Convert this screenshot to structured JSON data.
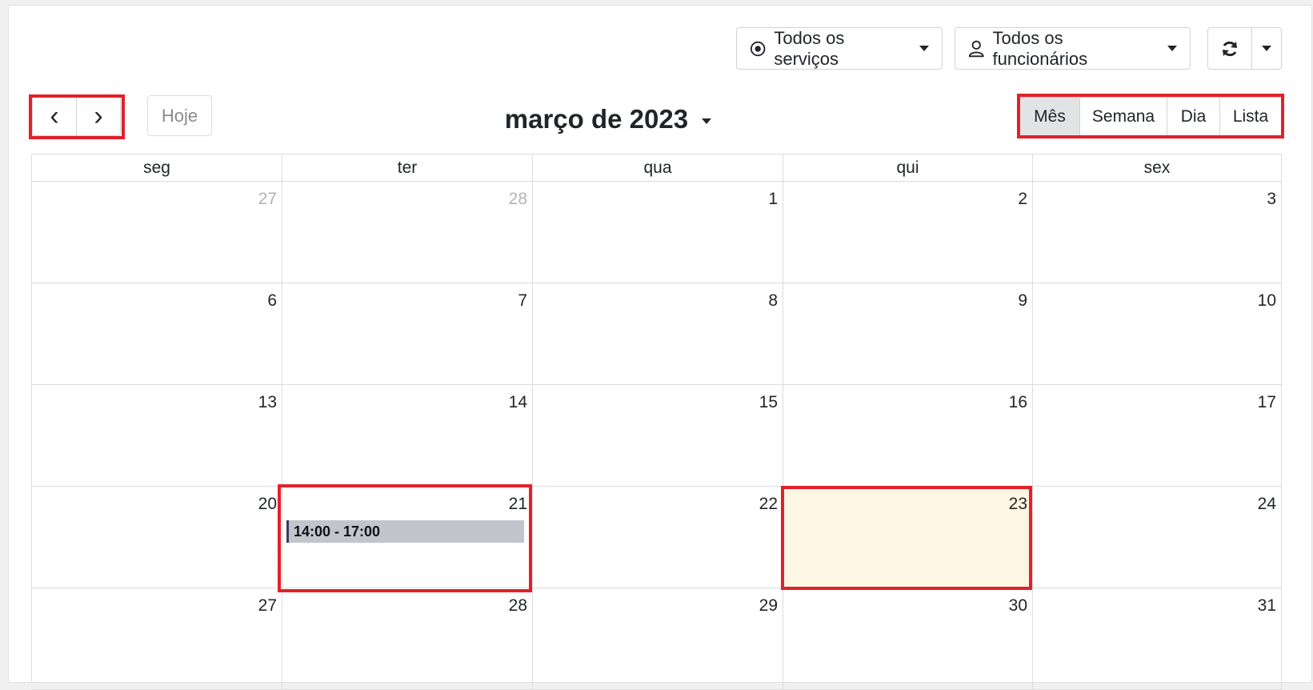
{
  "toolbar": {
    "services_label": "Todos os serviços",
    "employees_label": "Todos os funcionários",
    "today_label": "Hoje",
    "prev_icon": "‹",
    "next_icon": "›"
  },
  "calendar": {
    "title": "março de 2023",
    "views": [
      {
        "label": "Mês",
        "active": true
      },
      {
        "label": "Semana",
        "active": false
      },
      {
        "label": "Dia",
        "active": false
      },
      {
        "label": "Lista",
        "active": false
      }
    ],
    "weekdays": [
      "seg",
      "ter",
      "qua",
      "qui",
      "sex"
    ],
    "weeks": [
      [
        "27",
        "28",
        "1",
        "2",
        "3"
      ],
      [
        "6",
        "7",
        "8",
        "9",
        "10"
      ],
      [
        "13",
        "14",
        "15",
        "16",
        "17"
      ],
      [
        "20",
        "21",
        "22",
        "23",
        "24"
      ],
      [
        "27",
        "28",
        "29",
        "30",
        "31"
      ]
    ],
    "event": {
      "time": "14:00 - 17:00"
    }
  },
  "colors": {
    "highlight": "#e3202a",
    "today_bg": "#fdf6e2",
    "event_bg": "#c3c5cd",
    "active_view_bg": "#e2e3e5"
  }
}
